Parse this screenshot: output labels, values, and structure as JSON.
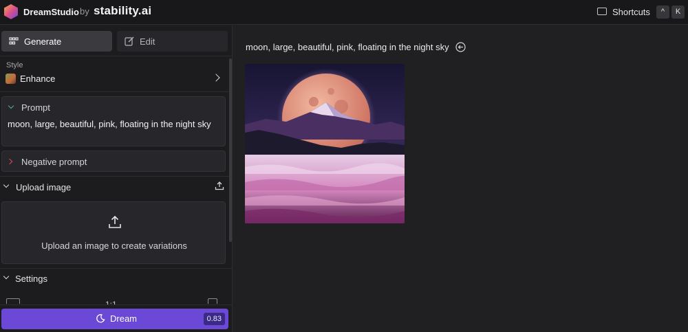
{
  "app": {
    "name": "DreamStudio",
    "by": "by",
    "company": "stability.ai"
  },
  "header": {
    "shortcuts_label": "Shortcuts",
    "keys": [
      "^",
      "K"
    ]
  },
  "tabs": [
    {
      "label": "Generate",
      "active": true,
      "icon": "grid-icon"
    },
    {
      "label": "Edit",
      "active": false,
      "icon": "edit-icon"
    }
  ],
  "style": {
    "label": "Style",
    "value": "Enhance"
  },
  "prompt": {
    "label": "Prompt",
    "text": "moon, large, beautiful, pink, floating in the night sky"
  },
  "negative_prompt": {
    "label": "Negative prompt"
  },
  "upload": {
    "label": "Upload image",
    "dropzone_text": "Upload an image to create variations"
  },
  "settings": {
    "label": "Settings",
    "aspect_ratio": "1:1"
  },
  "dream_button": {
    "label": "Dream",
    "cost": "0.83"
  },
  "main": {
    "prompt_heading": "moon, large, beautiful, pink, floating in the night sky"
  },
  "colors": {
    "accent": "#6b48d6",
    "background": "#202023",
    "sidebar": "#1c1c1f"
  }
}
